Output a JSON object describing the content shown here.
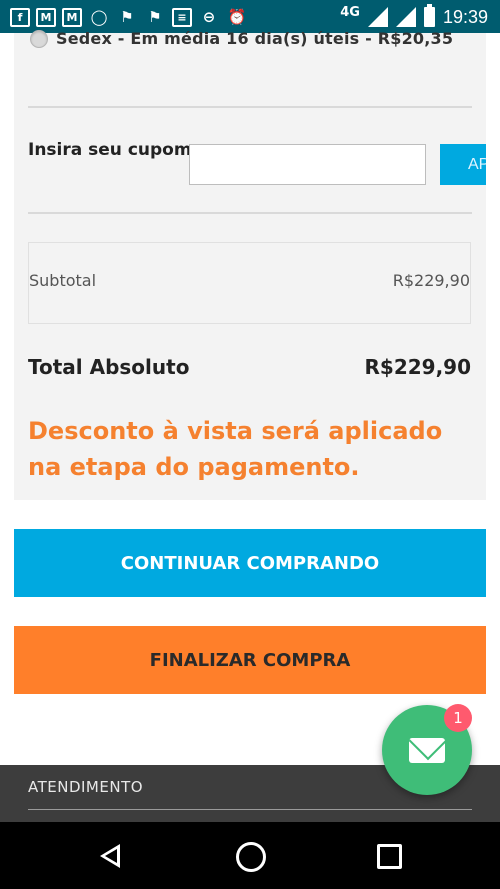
{
  "status_bar": {
    "icons": [
      "facebook-icon",
      "gmail-icon",
      "gmail-icon",
      "whatsapp-icon",
      "flag-icon",
      "flag-icon",
      "document-icon",
      "do-not-disturb-icon",
      "alarm-icon"
    ],
    "network": "4G",
    "time": "19:39"
  },
  "cart": {
    "shipping_option": "Sedex - Em média 16 dia(s) úteis - R$20,35",
    "coupon_label": "Insira seu cupom:",
    "coupon_value": "",
    "apply_label": "APLICAR",
    "subtotal_label": "Subtotal",
    "subtotal_value": "R$229,90",
    "total_label": "Total Absoluto",
    "total_value": "R$229,90",
    "discount_notice": "Desconto à vista será aplicado na etapa do pagamento."
  },
  "buttons": {
    "continue": "CONTINUAR COMPRANDO",
    "checkout": "FINALIZAR COMPRA"
  },
  "chat": {
    "badge_count": "1"
  },
  "footer": {
    "title": "ATENDIMENTO"
  },
  "colors": {
    "status_bar": "#005c6f",
    "blue": "#00a9e0",
    "orange": "#ff7f2a",
    "discount_text": "#f5812f",
    "chat_green": "#3fbd78"
  }
}
